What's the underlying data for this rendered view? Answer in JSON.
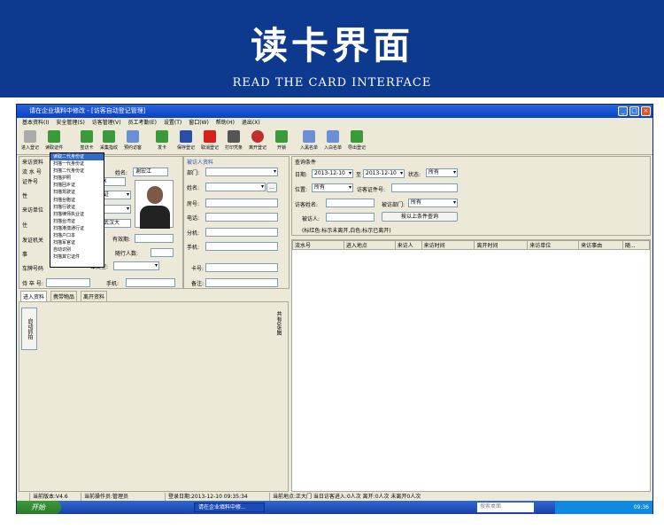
{
  "banner": {
    "title": "读卡界面",
    "subtitle": "READ THE CARD INTERFACE"
  },
  "window": {
    "title": "请在企业填料中修改 - [访客自动登记管理]"
  },
  "menu": [
    "基本资料(I)",
    "安全管理(S)",
    "访客管理(V)",
    "员工考勤(E)",
    "设置(T)",
    "窗口(W)",
    "帮助(H)",
    "退出(X)"
  ],
  "toolbar": [
    "进入登记",
    "读取证件",
    "签访卡",
    "采集指纹",
    "预约访客",
    "发卡",
    "保存登记",
    "取消登记",
    "打印凭条",
    "离开登记",
    "开锁",
    "入黑名单",
    "入白名单",
    "导出登记"
  ],
  "dropdown": [
    "读取二代身份证",
    "扫描一代身份证",
    "扫描二代身份证",
    "扫描护照",
    "扫描回乡证",
    "扫描驾驶证",
    "扫描台胞证",
    "扫描行驶证",
    "扫描律师执业证",
    "扫描台湾证",
    "扫描港澳通行证",
    "扫描户口本",
    "扫描军官证",
    "自动识别",
    "扫描其它证件"
  ],
  "visitor": {
    "section": "来访资料",
    "name_label": "流 水 号",
    "card_label": "证件号",
    "sex_label": "性",
    "type_label": "来访单位",
    "addr_label": "住",
    "office_label": "发证机关",
    "reason_label": "事",
    "car_label": "车牌号码",
    "escort_label": "侍 卒 号:",
    "name_field_label": "姓名:",
    "name_value": "谢宏江",
    "id_value": "303X",
    "idtype_value": "身份证",
    "addr_value": "湖北武汉大",
    "valid_label": "有效期:",
    "companions_label": "随行人数:",
    "cartype_label": "车类型:",
    "phone_label": "手机:"
  },
  "visitee": {
    "section": "被访人资料",
    "dept_label": "部门:",
    "name_label": "姓名:",
    "room_label": "房号:",
    "tel_label": "电话:",
    "ext_label": "分机:",
    "mobile_label": "手机:",
    "card_label": "卡号:",
    "remark_label": "备注:",
    "browse": "..."
  },
  "query": {
    "section": "查询条件",
    "date_label": "日期:",
    "date_from": "2013-12-10",
    "to_label": "至",
    "date_to": "2013-12-10",
    "state_label": "状态:",
    "state_value": "所有",
    "pos_label": "位置:",
    "pos_value": "所有",
    "idno_label": "访客证件号:",
    "vname_label": "访客姓名:",
    "dept_label": "被访部门:",
    "dept_value": "所有",
    "host_label": "被访人:",
    "search_button": "按以上条件查询",
    "note": "(标红色:标示未离开,白色:标示已离开)"
  },
  "tabs": [
    "进入资料",
    "携带物品",
    "离开资料"
  ],
  "capture_button": "启动抓拍",
  "photo_counter": "共有0张图",
  "grid": {
    "columns": [
      "流水号",
      "进入地点",
      "来访人",
      "来访时间",
      "离开时间",
      "来访单位",
      "来访事由",
      "随..."
    ]
  },
  "status": [
    "当前版本:V4.6",
    "当前操作员:管理员",
    "登录日期:2013-12-10 09:35:34",
    "当前地点:正大门 当日访客进入:0人次 离开:0人次 未离开0人次"
  ],
  "taskbar": {
    "start": "开始",
    "task": "请在企业填料中修...",
    "search": "搜索桌面",
    "clock": "09:36"
  },
  "colors": {
    "banner": "#0d3a8f",
    "titlebar": "#0842c4",
    "highlight": "#316ac5"
  }
}
